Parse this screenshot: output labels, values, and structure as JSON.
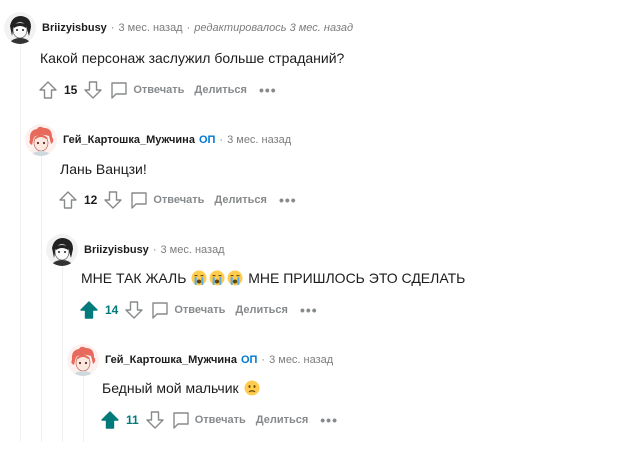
{
  "comments": [
    {
      "author": "Briizyisbusy",
      "op": "",
      "time": "3 мес. назад",
      "edited": "редактировалось 3 мес. назад",
      "text_before": "Какой персонаж заслужил больше страданий?",
      "text_after": "",
      "score": "15",
      "upvoted": false,
      "avatar": "dark-hair-avatar"
    },
    {
      "author": "Гей_Картошка_Мужчина",
      "op": "ОП",
      "time": "3 мес. назад",
      "edited": "",
      "text_before": "Лань Ванцзи!",
      "text_after": "",
      "score": "12",
      "upvoted": false,
      "avatar": "pink-hair-avatar"
    },
    {
      "author": "Briizyisbusy",
      "op": "",
      "time": "3 мес. назад",
      "edited": "",
      "text_before": "МНЕ ТАК ЖАЛЬ",
      "text_after": "МНЕ ПРИШЛОСЬ ЭТО СДЕЛАТЬ",
      "score": "14",
      "upvoted": true,
      "avatar": "dark-hair-avatar"
    },
    {
      "author": "Гей_Картошка_Мужчина",
      "op": "ОП",
      "time": "3 мес. назад",
      "edited": "",
      "text_before": "Бедный мой мальчик",
      "text_after": "",
      "score": "11",
      "upvoted": true,
      "avatar": "pink-hair-avatar"
    }
  ],
  "actions": {
    "reply": "Отвечать",
    "share": "Делиться",
    "more": "•••"
  },
  "icons": {
    "upvote": "upvote-arrow-icon",
    "downvote": "downvote-arrow-icon",
    "reply": "speech-bubble-icon",
    "crying": "loudly-crying-face-emoji",
    "sad": "frowning-face-emoji"
  },
  "colors": {
    "upvoted": "#007a7a",
    "op_badge": "#0079d3",
    "muted": "#878a8c",
    "thread_line": "#edeff1"
  }
}
